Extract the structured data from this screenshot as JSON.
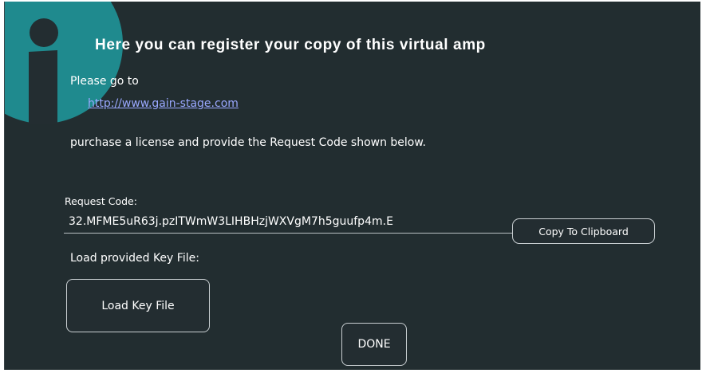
{
  "dialog": {
    "title": "Here you can register your copy of this virtual amp",
    "instruction_line1": "Please go to",
    "link": "http://www.gain-stage.com",
    "instruction_line2": "purchase a license and provide the Request Code shown below.",
    "request_code_label": "Request Code:",
    "request_code_value": "32.MFME5uR63j.pzITWmW3LIHBHzjWXVgM7h5guufp4m.E",
    "copy_button_label": "Copy To Clipboard",
    "key_file_label": "Load provided Key File:",
    "load_button_label": "Load Key File",
    "done_button_label": "DONE"
  },
  "colors": {
    "background": "#222d30",
    "info_circle": "#1f8a8e",
    "link": "#9aa8ff",
    "text": "#ffffff"
  },
  "icons": {
    "info": "info-icon"
  }
}
